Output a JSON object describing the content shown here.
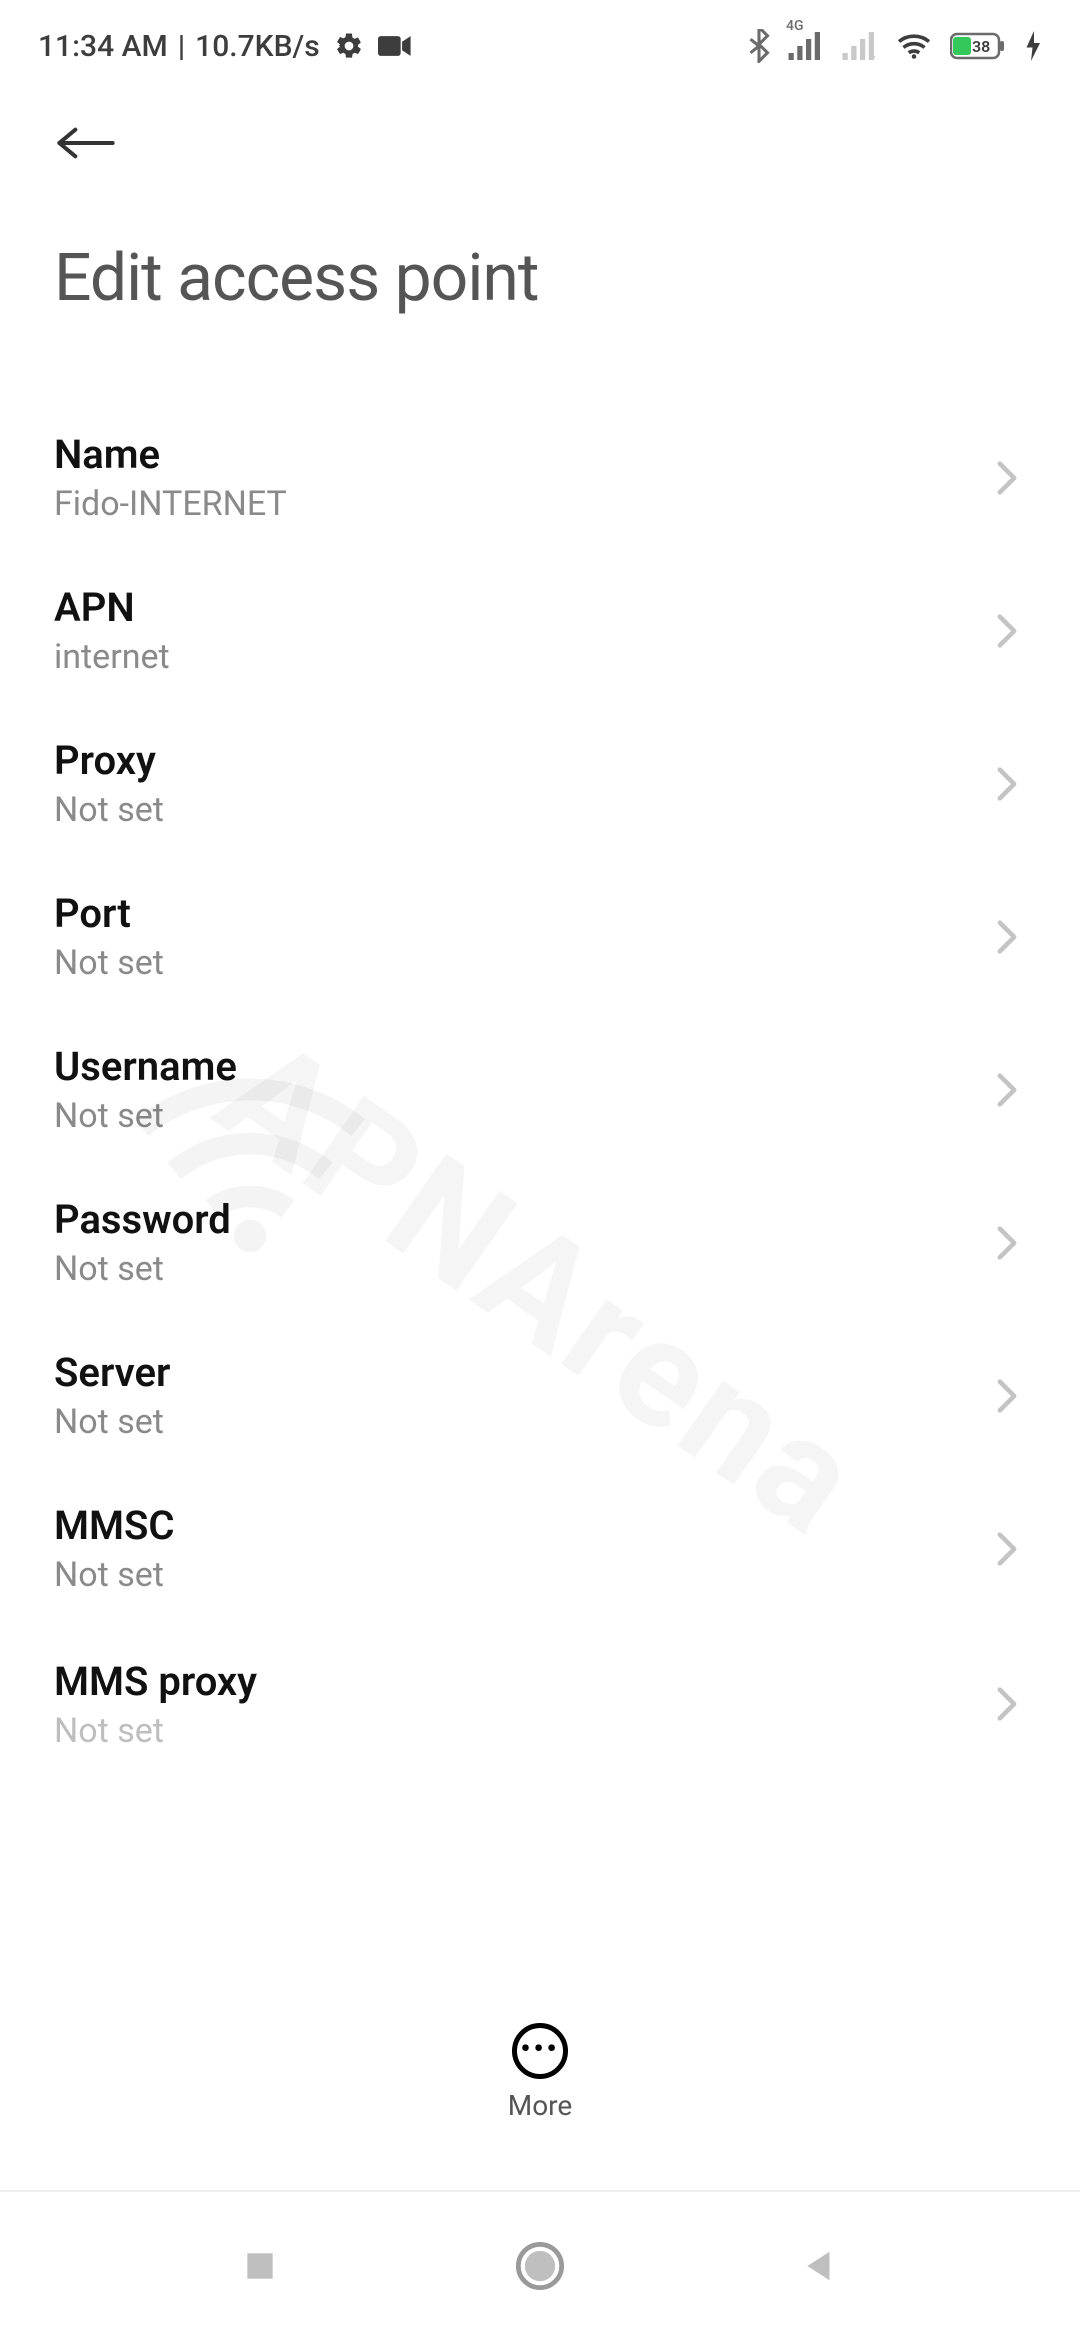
{
  "status": {
    "time": "11:34 AM",
    "speed": "10.7KB/s",
    "network_badge": "4G",
    "battery_percent": "38"
  },
  "header": {
    "title": "Edit access point"
  },
  "rows": [
    {
      "title": "Name",
      "value": "Fido-INTERNET"
    },
    {
      "title": "APN",
      "value": "internet"
    },
    {
      "title": "Proxy",
      "value": "Not set"
    },
    {
      "title": "Port",
      "value": "Not set"
    },
    {
      "title": "Username",
      "value": "Not set"
    },
    {
      "title": "Password",
      "value": "Not set"
    },
    {
      "title": "Server",
      "value": "Not set"
    },
    {
      "title": "MMSC",
      "value": "Not set"
    },
    {
      "title": "MMS proxy",
      "value": "Not set"
    }
  ],
  "bottom": {
    "more_label": "More"
  },
  "watermark": "APNArena"
}
